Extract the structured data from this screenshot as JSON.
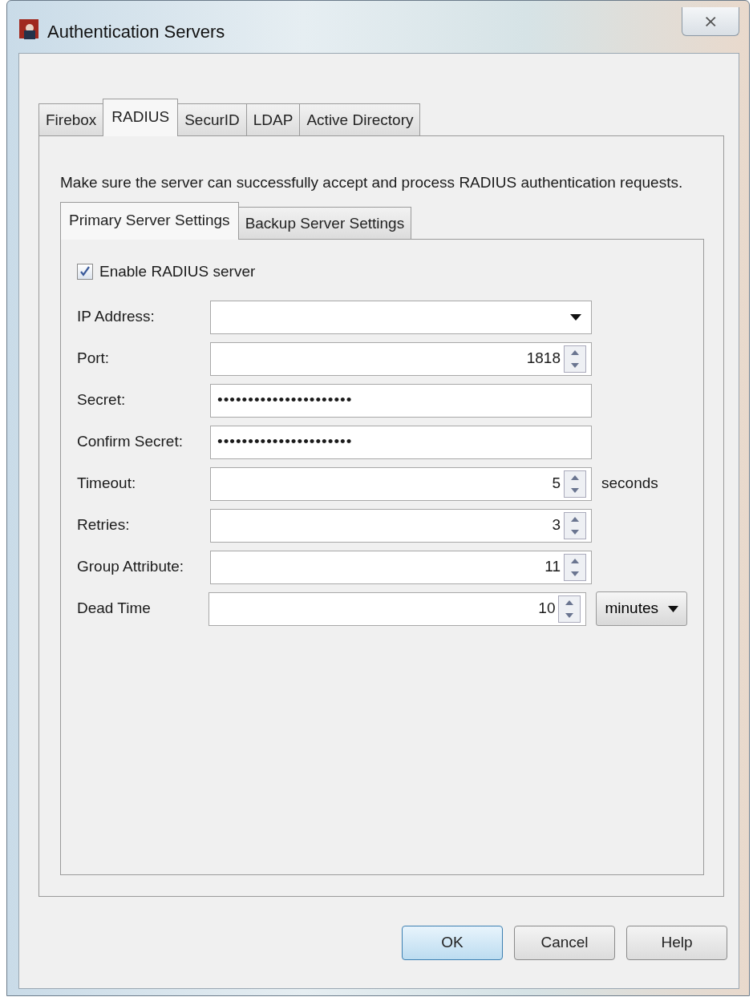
{
  "window": {
    "title": "Authentication Servers",
    "close": "⨯"
  },
  "tabs": [
    {
      "label": "Firebox",
      "selected": false
    },
    {
      "label": "RADIUS",
      "selected": true
    },
    {
      "label": "SecurID",
      "selected": false
    },
    {
      "label": "LDAP",
      "selected": false
    },
    {
      "label": "Active Directory",
      "selected": false
    }
  ],
  "description": "Make sure the server can successfully accept and process RADIUS authentication requests.",
  "subtabs": [
    {
      "label": "Primary Server Settings",
      "selected": true
    },
    {
      "label": "Backup Server Settings",
      "selected": false
    }
  ],
  "enable": {
    "label": "Enable RADIUS server",
    "checked": true
  },
  "fields": [
    {
      "kind": "combo",
      "label": "IP Address:"
    },
    {
      "kind": "spin",
      "label": "Port:",
      "value": "1818"
    },
    {
      "kind": "password",
      "label": "Secret:",
      "value": "••••••••••••••••••••••"
    },
    {
      "kind": "password",
      "label": "Confirm Secret:",
      "value": "••••••••••••••••••••••"
    },
    {
      "kind": "spin",
      "label": "Timeout:",
      "value": "5",
      "unit": "seconds"
    },
    {
      "kind": "spin",
      "label": "Retries:",
      "value": "3"
    },
    {
      "kind": "spin",
      "label": "Group Attribute:",
      "value": "11"
    },
    {
      "kind": "spin",
      "label": "Dead Time",
      "value": "10",
      "unit_select": "minutes"
    }
  ],
  "buttons": [
    {
      "label": "OK",
      "selected": true
    },
    {
      "label": "Cancel",
      "selected": false
    },
    {
      "label": "Help",
      "selected": false
    }
  ]
}
